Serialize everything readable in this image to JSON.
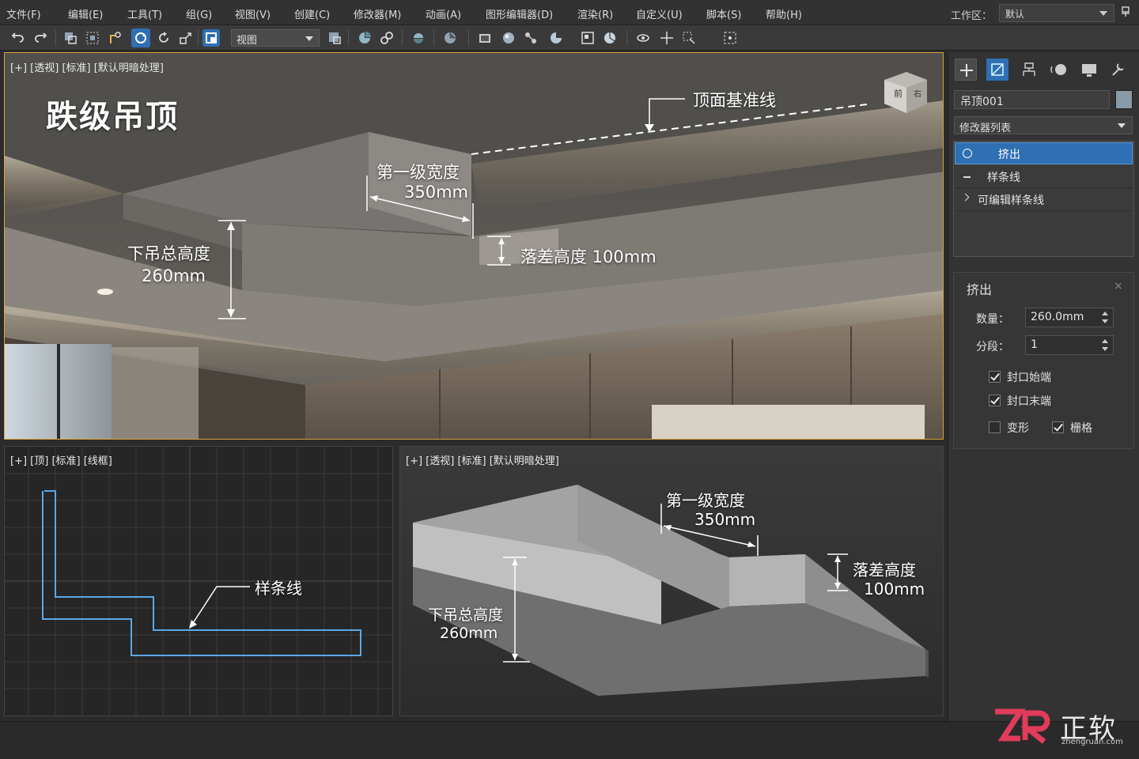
{
  "menu": {
    "items": [
      "文件(F)",
      "编辑(E)",
      "工具(T)",
      "组(G)",
      "视图(V)",
      "创建(C)",
      "修改器(M)",
      "动画(A)",
      "图形编辑器(D)",
      "渲染(R)",
      "自定义(U)",
      "脚本(S)",
      "帮助(H)"
    ],
    "workspace_label": "工作区：",
    "workspace_value": "默认"
  },
  "toolbar": {
    "view_select": "视图"
  },
  "viewport_main": {
    "label": "[+] [透视] [标准] [默认明暗处理]",
    "title": "跌级吊顶",
    "ann_top_line": "顶面基准线",
    "ann_width_line1": "第一级宽度",
    "ann_width_line2": "350mm",
    "ann_drop": "落差高度 100mm",
    "ann_total_line1": "下吊总高度",
    "ann_total_line2": "260mm",
    "viewcube_front": "前",
    "viewcube_right": "右"
  },
  "viewport_top": {
    "label": "[+] [顶] [标准] [线框]",
    "ann_spline": "样条线"
  },
  "viewport_persp": {
    "label": "[+] [透视] [标准] [默认明暗处理]",
    "ann_width_line1": "第一级宽度",
    "ann_width_line2": "350mm",
    "ann_drop_line1": "落差高度",
    "ann_drop_line2": "100mm",
    "ann_total_line1": "下吊总高度",
    "ann_total_line2": "260mm"
  },
  "panel": {
    "object_name": "吊顶001",
    "object_color": "#8a9aa6",
    "modifier_list": "修改器列表",
    "stack": [
      "挤出",
      "样条线",
      "可编辑样条线"
    ],
    "rollout_title": "挤出",
    "amount_label": "数量：",
    "amount_value": "260.0mm",
    "segments_label": "分段：",
    "segments_value": "1",
    "cap_start": "封口始端",
    "cap_end": "封口末端",
    "morph": "变形",
    "grid": "栅格"
  },
  "watermark": {
    "brand": "正软",
    "site": "zhengruan.com"
  },
  "colors": {
    "accent_blue": "#2f6fb3",
    "viewport_active": "#d9a23a",
    "spline_blue": "#5aa8e8"
  }
}
